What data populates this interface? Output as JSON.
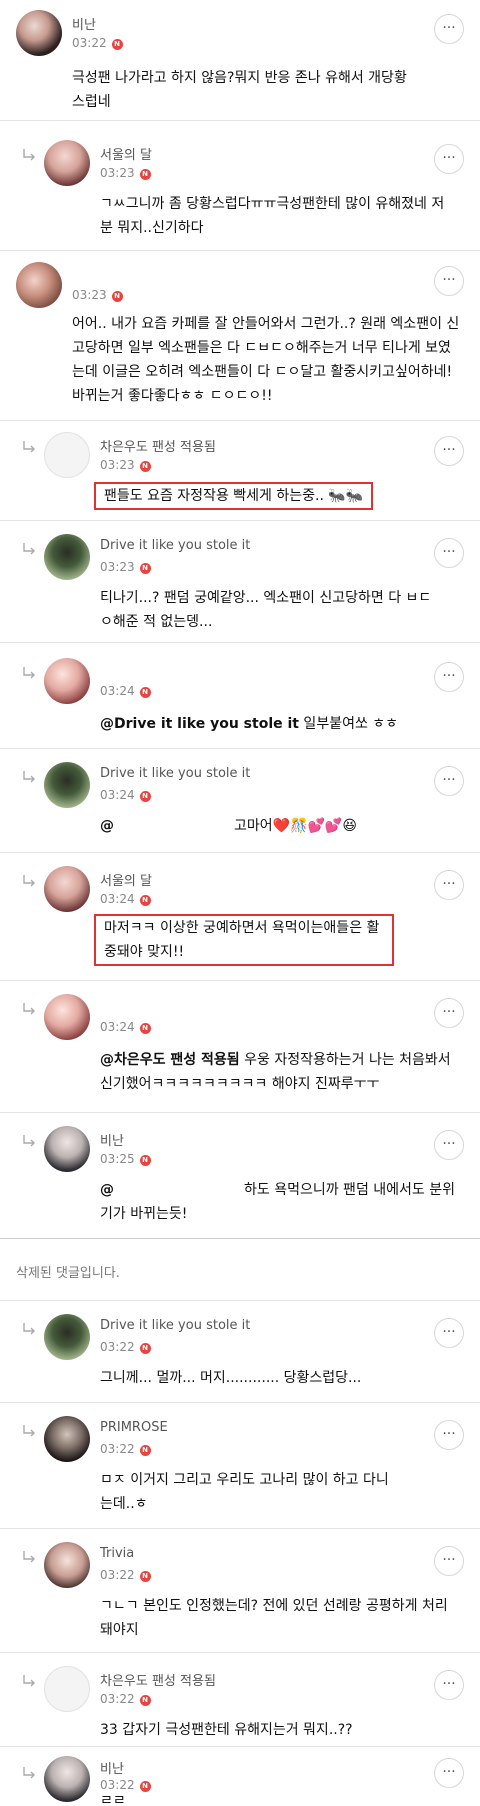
{
  "comments": [
    {
      "name": "비난",
      "time": "03:22",
      "badge": "N",
      "body": "극성팬 나가라고 하지 않음?뭐지 반응 존나 유해서 개당황스럽네"
    },
    {
      "name": "서울의 달",
      "time": "03:23",
      "badge": "N",
      "body": "ㄱㅆ그니까 좀 당황스럽다ㅠㅠ극성팬한테 많이 유해졌네 저분 뭐지..신기하다"
    },
    {
      "name": "",
      "time": "03:23",
      "badge": "N",
      "body": "어어.. 내가 요즘 카페를 잘 안들어와서 그런가..? 원래 엑소팬이 신고당하면 일부 엑소팬들은 다 ㄷㅂㄷㅇ해주는거 너무 티나게 보였는데 이글은 오히려 엑소팬들이 다 ㄷㅇ달고 활중시키고싶어하네! 바뀌는거 좋다좋다ㅎㅎ ㄷㅇㄷㅇ!!"
    },
    {
      "name": "차은우도 팬성 적용됨",
      "time": "03:23",
      "badge": "N",
      "body": "팬들도 요즘 자정작용 빡세게 하는중.. 🐜🐜"
    },
    {
      "name": "Drive it like you stole it",
      "time": "03:23",
      "badge": "N",
      "body": "티나기...? 팬덤 궁예같앙... 엑소팬이 신고당하면 다 ㅂㄷㅇ해준 적 없는뎅..."
    },
    {
      "name": "",
      "time": "03:24",
      "badge": "N",
      "mention": "@Drive it like you stole it",
      "body": " 일부붙여쏘 ㅎㅎ"
    },
    {
      "name": "Drive it like you stole it",
      "time": "03:24",
      "badge": "N",
      "mention": "@",
      "body": "고마어❤️🎊💕💕😆"
    },
    {
      "name": "서울의 달",
      "time": "03:24",
      "badge": "N",
      "body": "마저ㅋㅋ 이상한 궁예하면서 욕먹이는애들은 활중돼야 맞지!!"
    },
    {
      "name": "",
      "time": "03:24",
      "badge": "N",
      "mention": "@차은우도 팬성 적용됨",
      "body": " 우웅 자정작용하는거 나는 처음봐서 신기했어ㅋㅋㅋㅋㅋㅋㅋㅋㅋ 해야지 진짜루ㅜㅜ"
    },
    {
      "name": "비난",
      "time": "03:25",
      "badge": "N",
      "mention": "@",
      "body": "하도 욕먹으니까 팬덤 내에서도 분위기가 바뀌는듯!"
    },
    {
      "name": "Drive it like you stole it",
      "time": "03:22",
      "badge": "N",
      "body": "그니께... 멀까... 머지............ 당황스럽당..."
    },
    {
      "name": "PRIMROSE",
      "time": "03:22",
      "badge": "N",
      "body": "ㅁㅈ 이거지 그리고 우리도 고나리 많이 하고 다니는데..ㅎ"
    },
    {
      "name": "Trivia",
      "time": "03:22",
      "badge": "N",
      "body": "ㄱㄴㄱ 본인도 인정했는데? 전에 있던 선례랑 공평하게 처리 돼야지"
    },
    {
      "name": "차은우도 팬성 적용됨",
      "time": "03:22",
      "badge": "N",
      "body": "33 갑자기 극성팬한테 유해지는거 뭐지..??"
    },
    {
      "name": "비난",
      "time": "03:22",
      "badge": "N",
      "body": "ㄹㄹ"
    }
  ],
  "deleted_text": "삭제된 댓글입니다.",
  "more_label": "···",
  "colors": {
    "badge": "#e8433e",
    "highlight_border": "#dd3333"
  }
}
